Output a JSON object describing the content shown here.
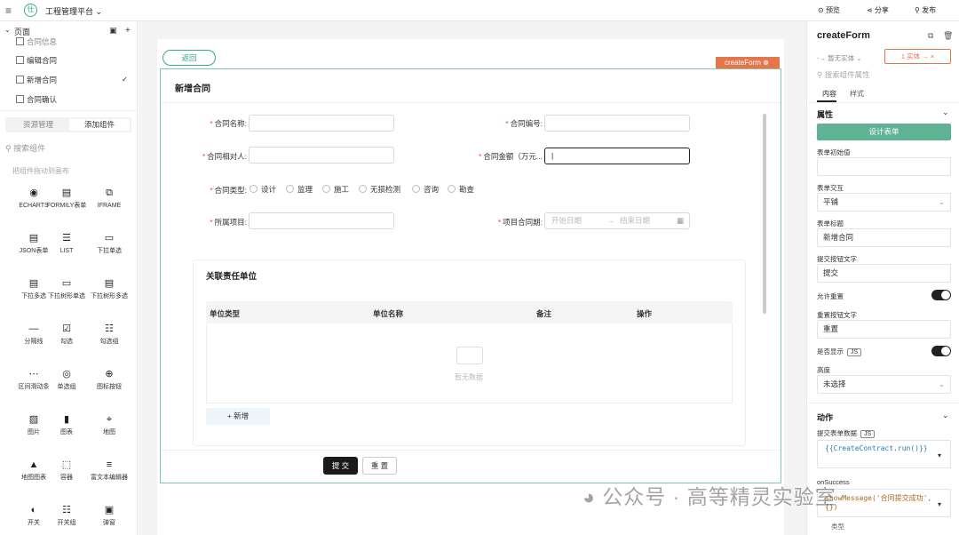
{
  "topbar": {
    "menu_icon": "≡",
    "app_title": "工程管理平台 ⌄",
    "preview": "预览",
    "share": "分享",
    "publish": "发布"
  },
  "left": {
    "pages_title": "页面",
    "pages": [
      "合同信息",
      "编辑合同",
      "新增合同",
      "合同确认"
    ],
    "tab_assets": "资源管理",
    "tab_add": "添加组件",
    "search_placeholder": "搜索组件",
    "drag_hint": "把组件拖动到画布",
    "components": [
      {
        "icon": "◉",
        "label": "ECHARTS"
      },
      {
        "icon": "▤",
        "label": "FORMILY表单"
      },
      {
        "icon": "⧉",
        "label": "IFRAME"
      },
      {
        "icon": "▤",
        "label": "JSON表单"
      },
      {
        "icon": "☰",
        "label": "LIST"
      },
      {
        "icon": "▭",
        "label": "下拉单选"
      },
      {
        "icon": "▤",
        "label": "下拉多选"
      },
      {
        "icon": "▭",
        "label": "下拉树形单选"
      },
      {
        "icon": "▤",
        "label": "下拉树形多选"
      },
      {
        "icon": "—",
        "label": "分隔线"
      },
      {
        "icon": "☑",
        "label": "勾选"
      },
      {
        "icon": "☷",
        "label": "勾选组"
      },
      {
        "icon": "⋯",
        "label": "区间滑动条"
      },
      {
        "icon": "◎",
        "label": "单选组"
      },
      {
        "icon": "⊕",
        "label": "图标按钮"
      },
      {
        "icon": "▨",
        "label": "图片"
      },
      {
        "icon": "▮",
        "label": "图表"
      },
      {
        "icon": "⌖",
        "label": "地图"
      },
      {
        "icon": "▲",
        "label": "地图图表"
      },
      {
        "icon": "⬚",
        "label": "容器"
      },
      {
        "icon": "≡",
        "label": "富文本编辑器"
      },
      {
        "icon": "◐",
        "label": "开关"
      },
      {
        "icon": "☷",
        "label": "开关组"
      },
      {
        "icon": "▣",
        "label": "弹窗"
      }
    ]
  },
  "canvas": {
    "back_button": "返回",
    "selected_tag": "createForm ⊗",
    "form_title": "新增合同",
    "fields": {
      "contract_name": "合同名称:",
      "contract_no": "合同编号:",
      "counterparty": "合同相对人:",
      "amount": "合同金额（万元...",
      "type": "合同类型:",
      "project": "所属项目:",
      "period": "项目合同期:"
    },
    "type_options": [
      "设计",
      "监理",
      "施工",
      "无损检测",
      "咨询",
      "勘查"
    ],
    "date_start": "开始日期",
    "date_arrow": "→",
    "date_end": "结束日期",
    "panel_title": "关联责任单位",
    "table_headers": [
      "单位类型",
      "单位名称",
      "备注",
      "操作"
    ],
    "empty_text": "暂无数据",
    "add_button": "+ 新增",
    "submit_button": "提 交",
    "reset_button": "重 置"
  },
  "right": {
    "title": "createForm",
    "entity_left": "-→ 暂无实体 ⌄",
    "entity_right": "1 实体 → ×",
    "search_placeholder": "搜索组件属性",
    "tab_content": "内容",
    "tab_style": "样式",
    "section_props": "属性",
    "design_button": "设计表单",
    "initial_value_label": "表单初始值",
    "interaction_label": "表单交互",
    "interaction_value": "平铺",
    "form_title_label": "表单标题",
    "form_title_value": "新增合同",
    "submit_text_label": "提交按钮文字",
    "submit_text_value": "提交",
    "allow_reset_label": "允许重置",
    "reset_text_label": "重置按钮文字",
    "reset_text_value": "重置",
    "show_label": "是否显示",
    "height_label": "高度",
    "height_value": "未选择",
    "section_actions": "动作",
    "submit_data_label": "提交表单数据",
    "submit_data_code": "{{CreateContract.run()}}",
    "on_success_label": "onSuccess",
    "on_success_code": "showMessage('合同提交成功', {})",
    "type_label": "类型",
    "js_badge": "JS"
  },
  "watermark": "公众号 · 高等精灵实验室"
}
